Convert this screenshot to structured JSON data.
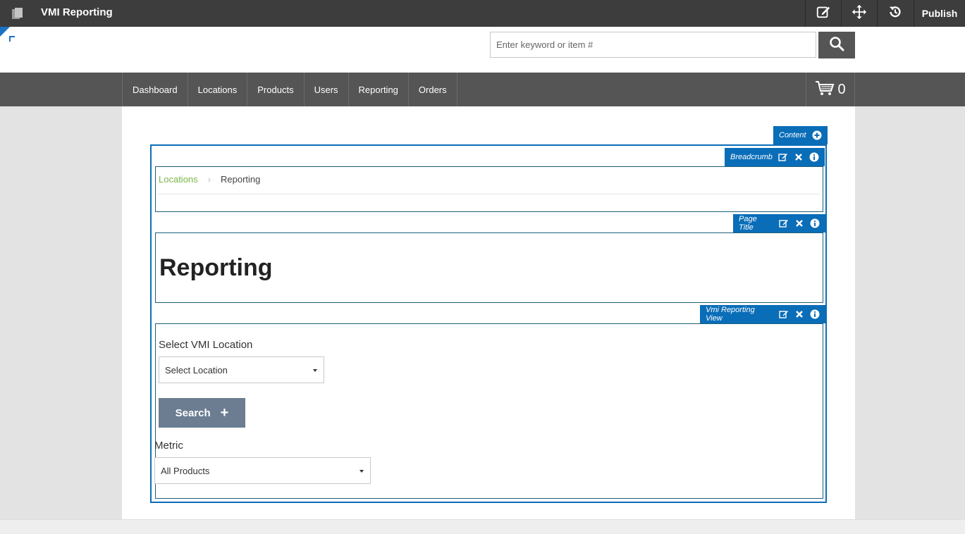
{
  "topbar": {
    "title": "VMI Reporting",
    "publish_label": "Publish",
    "tools": [
      "edit-icon",
      "move-icon",
      "history-icon"
    ]
  },
  "header": {
    "search_placeholder": "Enter keyword or item #"
  },
  "nav": {
    "items": [
      "Dashboard",
      "Locations",
      "Products",
      "Users",
      "Reporting",
      "Orders"
    ],
    "cart_count": "0"
  },
  "zones": {
    "content_label": "Content",
    "breadcrumb_label": "Breadcrumb",
    "page_title_label": "Page Title",
    "vmi_view_label": "Vmi Reporting View"
  },
  "breadcrumb": {
    "items": [
      "Locations",
      "Reporting"
    ]
  },
  "page": {
    "title": "Reporting"
  },
  "vmi": {
    "location_label": "Select VMI Location",
    "location_value": "Select Location",
    "search_label": "Search",
    "metric_label": "Metric",
    "metric_value": "All Products"
  },
  "colors": {
    "accent": "#0a6db8",
    "link_green": "#7ab648",
    "button_gray": "#6c7d92"
  }
}
